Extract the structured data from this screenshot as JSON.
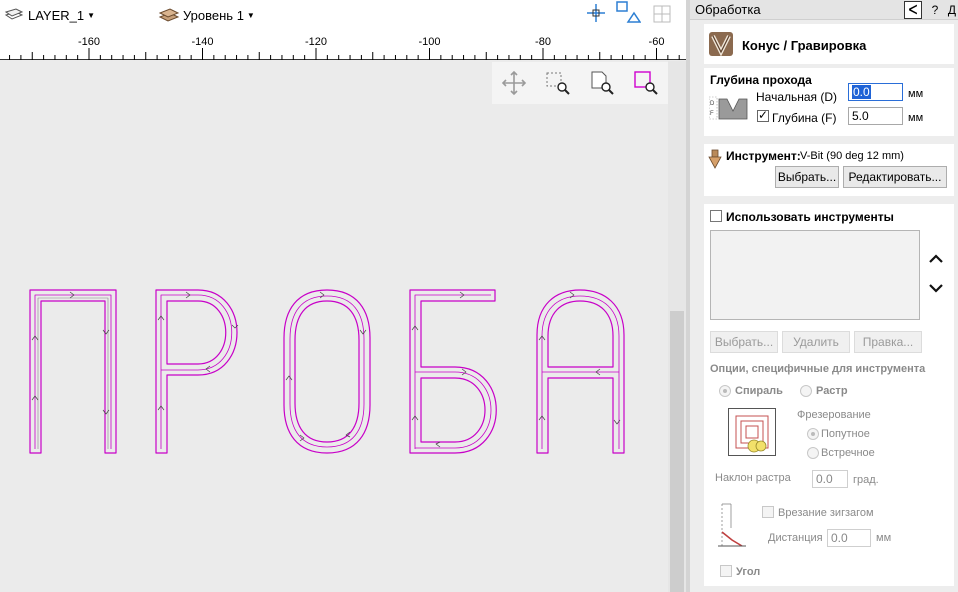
{
  "toolbar": {
    "layer_label": "LAYER_1",
    "level_label": "Уровень 1"
  },
  "ruler": {
    "labels": [
      "-160",
      "-140",
      "-120",
      "-100",
      "-80",
      "-60"
    ]
  },
  "canvas": {
    "preview_letters": [
      "П",
      "Р",
      "О",
      "Б",
      "А"
    ],
    "toolpath_color": "#c800c8"
  },
  "panel": {
    "title": "Обработка",
    "pin_label": "ᐸ",
    "help_label": "?",
    "close_label": "Д",
    "toolpath_name": "Конус / Гравировка",
    "depth": {
      "heading": "Глубина прохода",
      "start_label": "Начальная (D)",
      "start_value": "0.0",
      "start_unit": "мм",
      "depth_label": "Глубина (F)",
      "depth_checked": true,
      "depth_value": "5.0",
      "depth_unit": "мм"
    },
    "tool": {
      "label": "Инструмент:",
      "value": "V-Bit (90 deg 12 mm)",
      "select_button": "Выбрать...",
      "edit_button": "Редактировать..."
    },
    "multi_tools": {
      "checkbox_label": "Использовать инструменты",
      "checked": false,
      "up_icon": "chevron-up-icon",
      "down_icon": "chevron-down-icon",
      "select_button": "Выбрать...",
      "delete_button": "Удалить",
      "edit_button": "Правка..."
    },
    "options": {
      "heading": "Опции, специфичные для инструмента",
      "spiral_label": "Спираль",
      "raster_label": "Растр",
      "milling_heading": "Фрезерование",
      "climb_label": "Попутное",
      "conventional_label": "Встречное",
      "raster_angle_label": "Наклон растра",
      "raster_angle_value": "0.0",
      "raster_angle_unit": "град.",
      "ramp_label": "Врезание зигзагом",
      "distance_label": "Дистанция",
      "distance_value": "0.0",
      "distance_unit": "мм",
      "corner_label": "Угол"
    }
  }
}
